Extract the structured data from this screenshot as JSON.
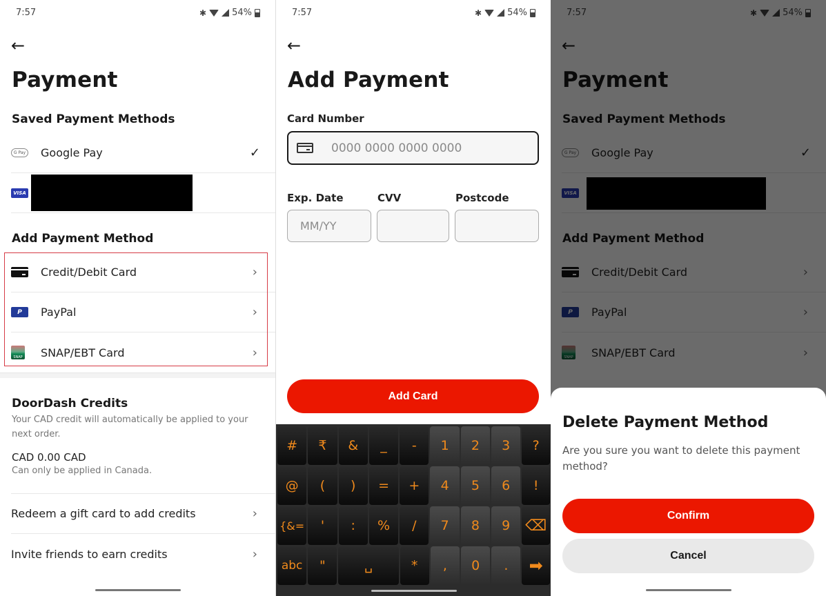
{
  "status_bar": {
    "time": "7:57",
    "battery": "54%",
    "bluetooth_icon": "bluetooth-icon",
    "wifi_icon": "wifi-icon",
    "signal_icon": "signal-icon",
    "battery_icon": "battery-icon"
  },
  "payment_screen": {
    "title": "Payment",
    "saved_heading": "Saved Payment Methods",
    "saved_methods": [
      {
        "label": "Google Pay",
        "icon": "google-pay-icon",
        "icon_text": "G Pay",
        "selected": true
      },
      {
        "label": "",
        "icon": "visa-icon",
        "icon_text": "VISA",
        "redacted": true
      }
    ],
    "add_heading": "Add Payment Method",
    "add_methods": [
      {
        "label": "Credit/Debit Card",
        "icon": "credit-card-icon"
      },
      {
        "label": "PayPal",
        "icon": "paypal-icon",
        "icon_text": "P"
      },
      {
        "label": "SNAP/EBT Card",
        "icon": "snap-ebt-icon",
        "icon_text": "SNAP"
      }
    ],
    "credits": {
      "heading": "DoorDash Credits",
      "description": "Your CAD credit will automatically be applied to your next order.",
      "amount": "CAD 0.00 CAD",
      "note": "Can only be applied in Canada."
    },
    "links": [
      {
        "label": "Redeem a gift card to add credits"
      },
      {
        "label": "Invite friends to earn credits"
      }
    ]
  },
  "add_payment_screen": {
    "title": "Add Payment",
    "card_number_label": "Card Number",
    "card_number_placeholder": "0000 0000 0000 0000",
    "card_number_value": "",
    "exp_label": "Exp. Date",
    "exp_placeholder": "MM/YY",
    "cvv_label": "CVV",
    "cvv_placeholder": "",
    "postcode_label": "Postcode",
    "postcode_placeholder": "",
    "submit_label": "Add Card",
    "keyboard_rows": [
      [
        "#",
        "₹",
        "&",
        "_",
        "-",
        "1",
        "2",
        "3",
        "?"
      ],
      [
        "@",
        "(",
        ")",
        "=",
        "+",
        "4",
        "5",
        "6",
        "!"
      ],
      [
        "{&=",
        "'",
        ":",
        "%",
        "/",
        "7",
        "8",
        "9",
        "⌫"
      ],
      [
        "abc",
        "\"",
        "␣",
        "*",
        ",",
        "0",
        ".",
        "➡"
      ]
    ]
  },
  "delete_dialog": {
    "title": "Delete Payment Method",
    "message": "Are you sure you want to delete this payment method?",
    "confirm_label": "Confirm",
    "cancel_label": "Cancel"
  },
  "colors": {
    "brand_red": "#eb1700",
    "highlight_border": "#d63a45",
    "keyboard_text": "#f08a1c"
  },
  "glyphs": {
    "back": "←",
    "chevron": "›",
    "check": "✓",
    "bluetooth": "✱"
  }
}
